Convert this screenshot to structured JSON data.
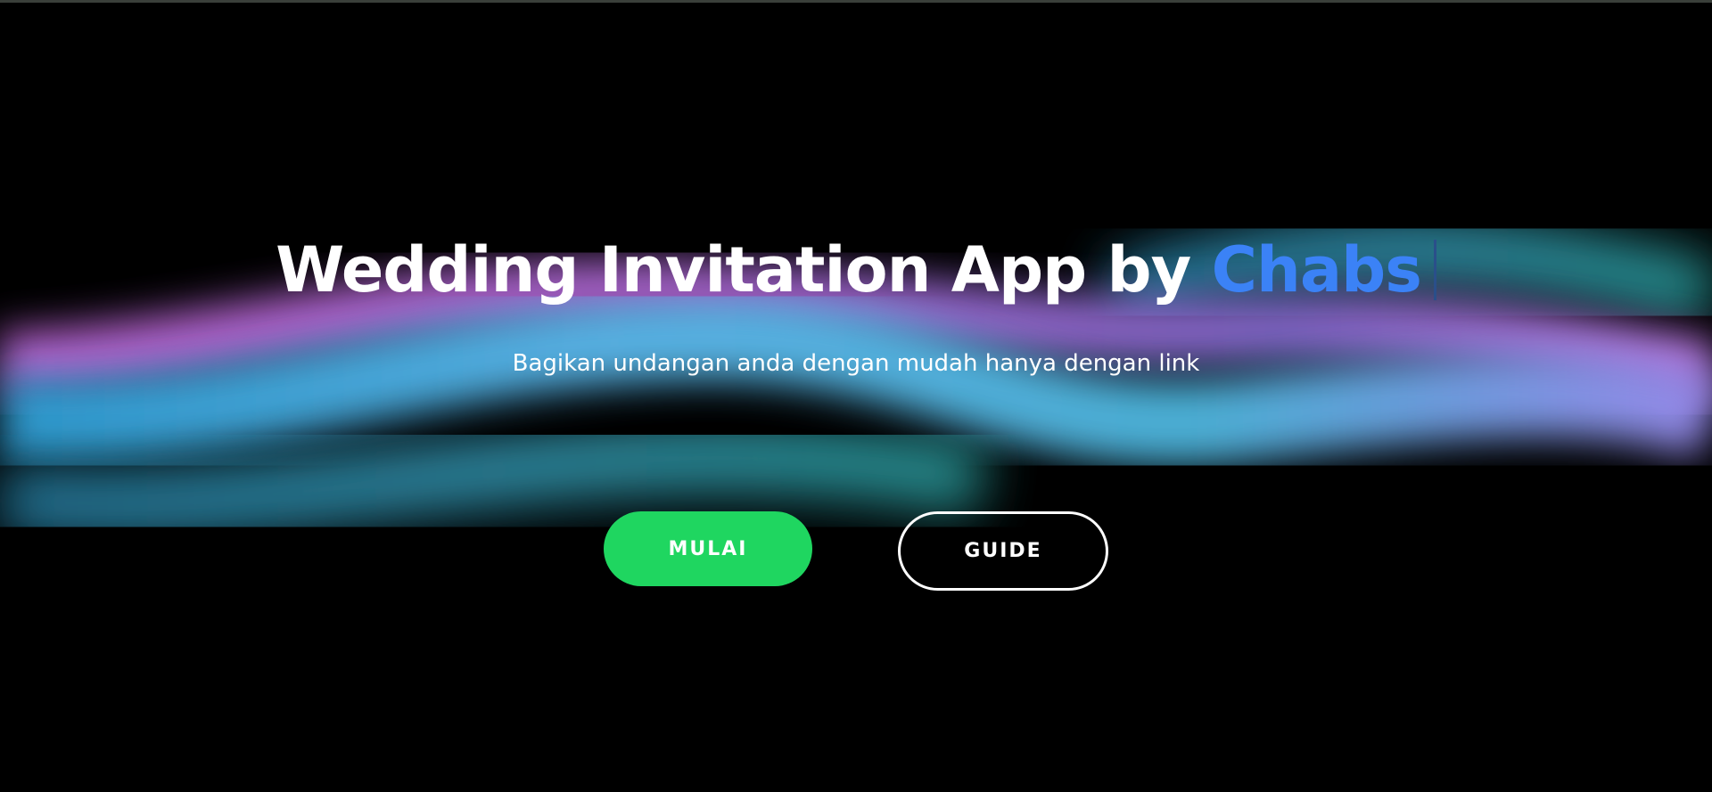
{
  "hero": {
    "title_main": "Wedding Invitation App by ",
    "title_accent": "Chabs",
    "subtitle": "Bagikan undangan anda dengan mudah hanya dengan link"
  },
  "buttons": {
    "start_label": "MULAI",
    "guide_label": "GUIDE"
  },
  "colors": {
    "background": "#000000",
    "accent": "#3b82f6",
    "start_button": "#1fd660",
    "wave_cyan": "#4fb3e8",
    "wave_magenta": "#c77ae8",
    "wave_teal": "#2aa6b8"
  }
}
